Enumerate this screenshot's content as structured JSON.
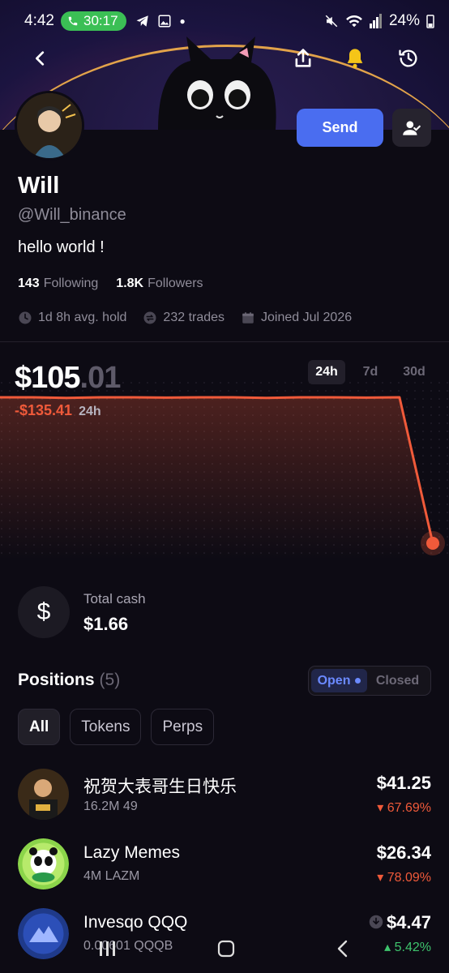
{
  "status_bar": {
    "time": "4:42",
    "call_duration": "30:17",
    "battery": "24%"
  },
  "top_icons": [
    "back-icon",
    "share-icon",
    "bell-icon",
    "history-icon"
  ],
  "profile": {
    "name": "Will",
    "handle": "@Will_binance",
    "bio": "hello world !",
    "following_count": "143",
    "following_label": "Following",
    "followers_count": "1.8K",
    "followers_label": "Followers",
    "avg_hold": "1d 8h avg. hold",
    "trades": "232 trades",
    "joined": "Joined Jul 2026",
    "send_label": "Send"
  },
  "portfolio": {
    "balance_main": "$105",
    "balance_cents": ".01",
    "pnl": "-$135.41",
    "pnl_period": "24h",
    "ranges": [
      "24h",
      "7d",
      "30d"
    ],
    "active_range": "24h",
    "accent_color": "#f05a3a"
  },
  "chart_data": {
    "type": "line",
    "series": [
      {
        "values": [
          1.0,
          1.0,
          0.998,
          1.0,
          1.0,
          0.999,
          1.0,
          1.0,
          0.998,
          1.0,
          1.0,
          0.999,
          1.0,
          0.55
        ]
      }
    ],
    "x": [
      0,
      1,
      2,
      3,
      4,
      5,
      6,
      7,
      8,
      9,
      10,
      11,
      12,
      13
    ],
    "ylim": [
      0.5,
      1.05
    ]
  },
  "cash": {
    "label": "Total cash",
    "value": "$1.66",
    "icon_glyph": "$"
  },
  "positions": {
    "title": "Positions",
    "count": "(5)",
    "open_label": "Open",
    "closed_label": "Closed",
    "filters": [
      "All",
      "Tokens",
      "Perps"
    ],
    "items": [
      {
        "name": "祝贺大表哥生日快乐",
        "sub": "16.2M 49",
        "value": "$41.25",
        "change": "▾ 67.69%",
        "direction": "down"
      },
      {
        "name": "Lazy Memes",
        "sub": "4M LAZM",
        "value": "$26.34",
        "change": "▾ 78.09%",
        "direction": "down"
      },
      {
        "name": "Invesqo QQQ",
        "sub": "0.00601 QQQB",
        "value": "$4.47",
        "change": "▴ 5.42%",
        "direction": "up"
      }
    ]
  }
}
